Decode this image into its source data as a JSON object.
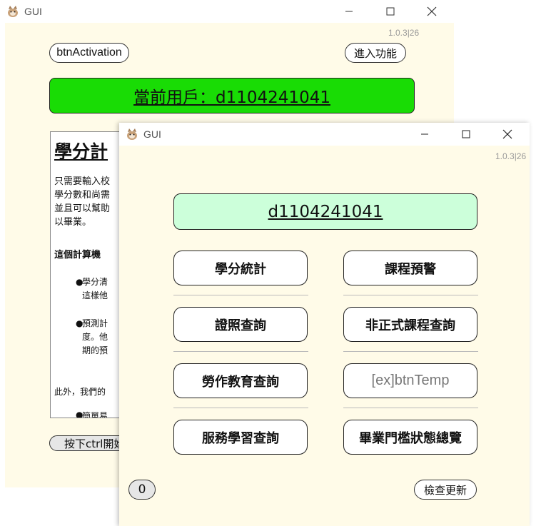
{
  "back_window": {
    "title": "GUI",
    "version": "1.0.3|26",
    "activation_label": "btnActivation",
    "enter_label": "進入功能",
    "user_banner": "當前用戶：d1104241041",
    "doc": {
      "heading": "學分計",
      "para1": [
        "只需要輸入校",
        "學分數和尚需",
        "並且可以幫助",
        "以畢業。"
      ],
      "bold_line": "這個計算機",
      "bullet1": [
        "學分清",
        "這樣他"
      ],
      "bullet2": [
        "預測計",
        "度。他",
        "期的預"
      ],
      "para2": "此外，我們的",
      "bullet3": "簡單易"
    },
    "bottom_button": "按下ctrl開始"
  },
  "front_window": {
    "title": "GUI",
    "version": "1.0.3|26",
    "user_id": "d1104241041",
    "buttons": [
      "學分統計",
      "課程預警",
      "證照查詢",
      "非正式課程查詢",
      "勞作教育查詢",
      "[ex]btnTemp",
      "服務學習查詢",
      "畢業門檻狀態總覽"
    ],
    "counter": "0",
    "update_label": "檢查更新"
  },
  "colors": {
    "client_bg": "#fffbe8",
    "banner_green": "#19dc05",
    "id_box": "#ccffda",
    "disabled_text": "#777777"
  }
}
